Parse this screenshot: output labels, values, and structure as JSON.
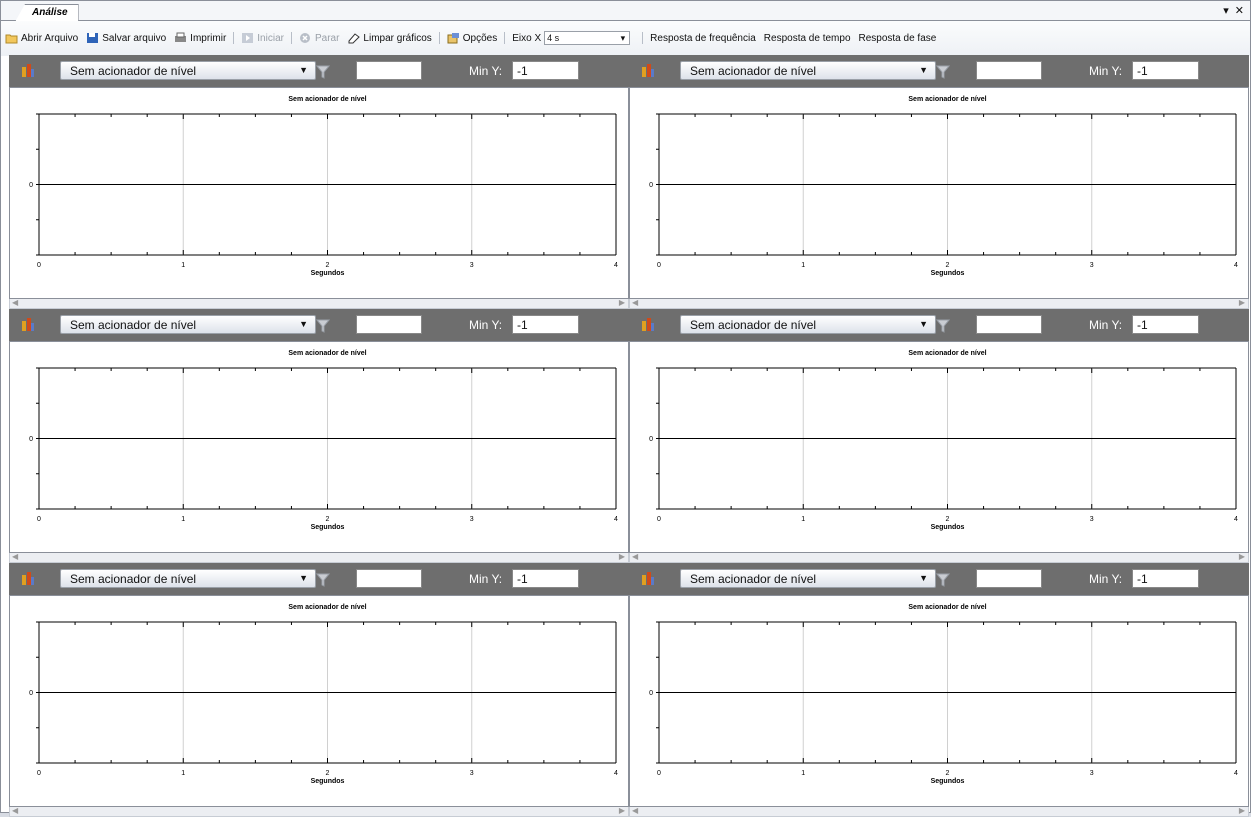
{
  "window": {
    "tab_title": "Análise",
    "dropdown_glyph": "▾",
    "close_glyph": "✕"
  },
  "toolbar": {
    "open_label": "Abrir Arquivo",
    "save_label": "Salvar arquivo",
    "print_label": "Imprimir",
    "start_label": "Iniciar",
    "stop_label": "Parar",
    "clear_label": "Limpar gráficos",
    "options_label": "Opções",
    "eixo_label": "Eixo X",
    "eixo_value": "4 s",
    "freq_label": "Resposta de frequência",
    "time_label": "Resposta de tempo",
    "phase_label": "Resposta de fase"
  },
  "panels": [
    {
      "trigger": "Sem acionador de nível",
      "filter_text": "",
      "miny_label": "Min Y:",
      "miny_value": "-1",
      "chart_title": "Sem acionador de nível",
      "xlabel": "Segundos"
    },
    {
      "trigger": "Sem acionador de nível",
      "filter_text": "",
      "miny_label": "Min Y:",
      "miny_value": "-1",
      "chart_title": "Sem acionador de nível",
      "xlabel": "Segundos"
    },
    {
      "trigger": "Sem acionador de nível",
      "filter_text": "",
      "miny_label": "Min Y:",
      "miny_value": "-1",
      "chart_title": "Sem acionador de nível",
      "xlabel": "Segundos"
    },
    {
      "trigger": "Sem acionador de nível",
      "filter_text": "",
      "miny_label": "Min Y:",
      "miny_value": "-1",
      "chart_title": "Sem acionador de nível",
      "xlabel": "Segundos"
    },
    {
      "trigger": "Sem acionador de nível",
      "filter_text": "",
      "miny_label": "Min Y:",
      "miny_value": "-1",
      "chart_title": "Sem acionador de nível",
      "xlabel": "Segundos"
    },
    {
      "trigger": "Sem acionador de nível",
      "filter_text": "",
      "miny_label": "Min Y:",
      "miny_value": "-1",
      "chart_title": "Sem acionador de nível",
      "xlabel": "Segundos"
    }
  ],
  "chart_data": [
    {
      "type": "line",
      "title": "Sem acionador de nível",
      "xlabel": "Segundos",
      "ylabel": "",
      "xlim": [
        0,
        4
      ],
      "xticks": [
        0,
        1,
        2,
        3,
        4
      ],
      "ylim": [
        -1,
        1
      ],
      "yticks": [
        0
      ],
      "series": [
        {
          "x": [
            0,
            4
          ],
          "y": [
            0,
            0
          ]
        }
      ],
      "grid": "vertical"
    },
    {
      "type": "line",
      "title": "Sem acionador de nível",
      "xlabel": "Segundos",
      "ylabel": "",
      "xlim": [
        0,
        4
      ],
      "xticks": [
        0,
        1,
        2,
        3,
        4
      ],
      "ylim": [
        -1,
        1
      ],
      "yticks": [
        0
      ],
      "series": [
        {
          "x": [
            0,
            4
          ],
          "y": [
            0,
            0
          ]
        }
      ],
      "grid": "vertical"
    },
    {
      "type": "line",
      "title": "Sem acionador de nível",
      "xlabel": "Segundos",
      "ylabel": "",
      "xlim": [
        0,
        4
      ],
      "xticks": [
        0,
        1,
        2,
        3,
        4
      ],
      "ylim": [
        -1,
        1
      ],
      "yticks": [
        0
      ],
      "series": [
        {
          "x": [
            0,
            4
          ],
          "y": [
            0,
            0
          ]
        }
      ],
      "grid": "vertical"
    },
    {
      "type": "line",
      "title": "Sem acionador de nível",
      "xlabel": "Segundos",
      "ylabel": "",
      "xlim": [
        0,
        4
      ],
      "xticks": [
        0,
        1,
        2,
        3,
        4
      ],
      "ylim": [
        -1,
        1
      ],
      "yticks": [
        0
      ],
      "series": [
        {
          "x": [
            0,
            4
          ],
          "y": [
            0,
            0
          ]
        }
      ],
      "grid": "vertical"
    },
    {
      "type": "line",
      "title": "Sem acionador de nível",
      "xlabel": "Segundos",
      "ylabel": "",
      "xlim": [
        0,
        4
      ],
      "xticks": [
        0,
        1,
        2,
        3,
        4
      ],
      "ylim": [
        -1,
        1
      ],
      "yticks": [
        0
      ],
      "series": [
        {
          "x": [
            0,
            4
          ],
          "y": [
            0,
            0
          ]
        }
      ],
      "grid": "vertical"
    },
    {
      "type": "line",
      "title": "Sem acionador de nível",
      "xlabel": "Segundos",
      "ylabel": "",
      "xlim": [
        0,
        4
      ],
      "xticks": [
        0,
        1,
        2,
        3,
        4
      ],
      "ylim": [
        -1,
        1
      ],
      "yticks": [
        0
      ],
      "series": [
        {
          "x": [
            0,
            4
          ],
          "y": [
            0,
            0
          ]
        }
      ],
      "grid": "vertical"
    }
  ],
  "colors": {
    "panel_header": "#6e6e6e",
    "grid": "#d0d0d0",
    "axis": "#000000"
  }
}
